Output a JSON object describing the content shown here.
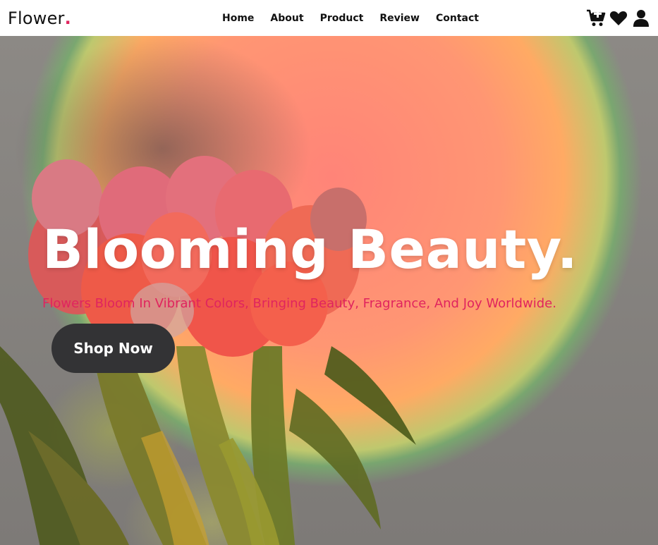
{
  "brand": {
    "name": "Flower",
    "dot": "."
  },
  "nav": {
    "items": [
      "Home",
      "About",
      "Product",
      "Review",
      "Contact"
    ]
  },
  "header_icons": [
    "cart-plus-icon",
    "heart-icon",
    "user-icon"
  ],
  "hero": {
    "title": "Blooming Beauty.",
    "subtitle": "Flowers Bloom In Vibrant Colors, Bringing Beauty, Fragrance, And Joy Worldwide.",
    "cta_label": "Shop Now"
  },
  "colors": {
    "accent": "#e0245e",
    "button_bg": "#333335",
    "header_bg": "#ffffff"
  }
}
